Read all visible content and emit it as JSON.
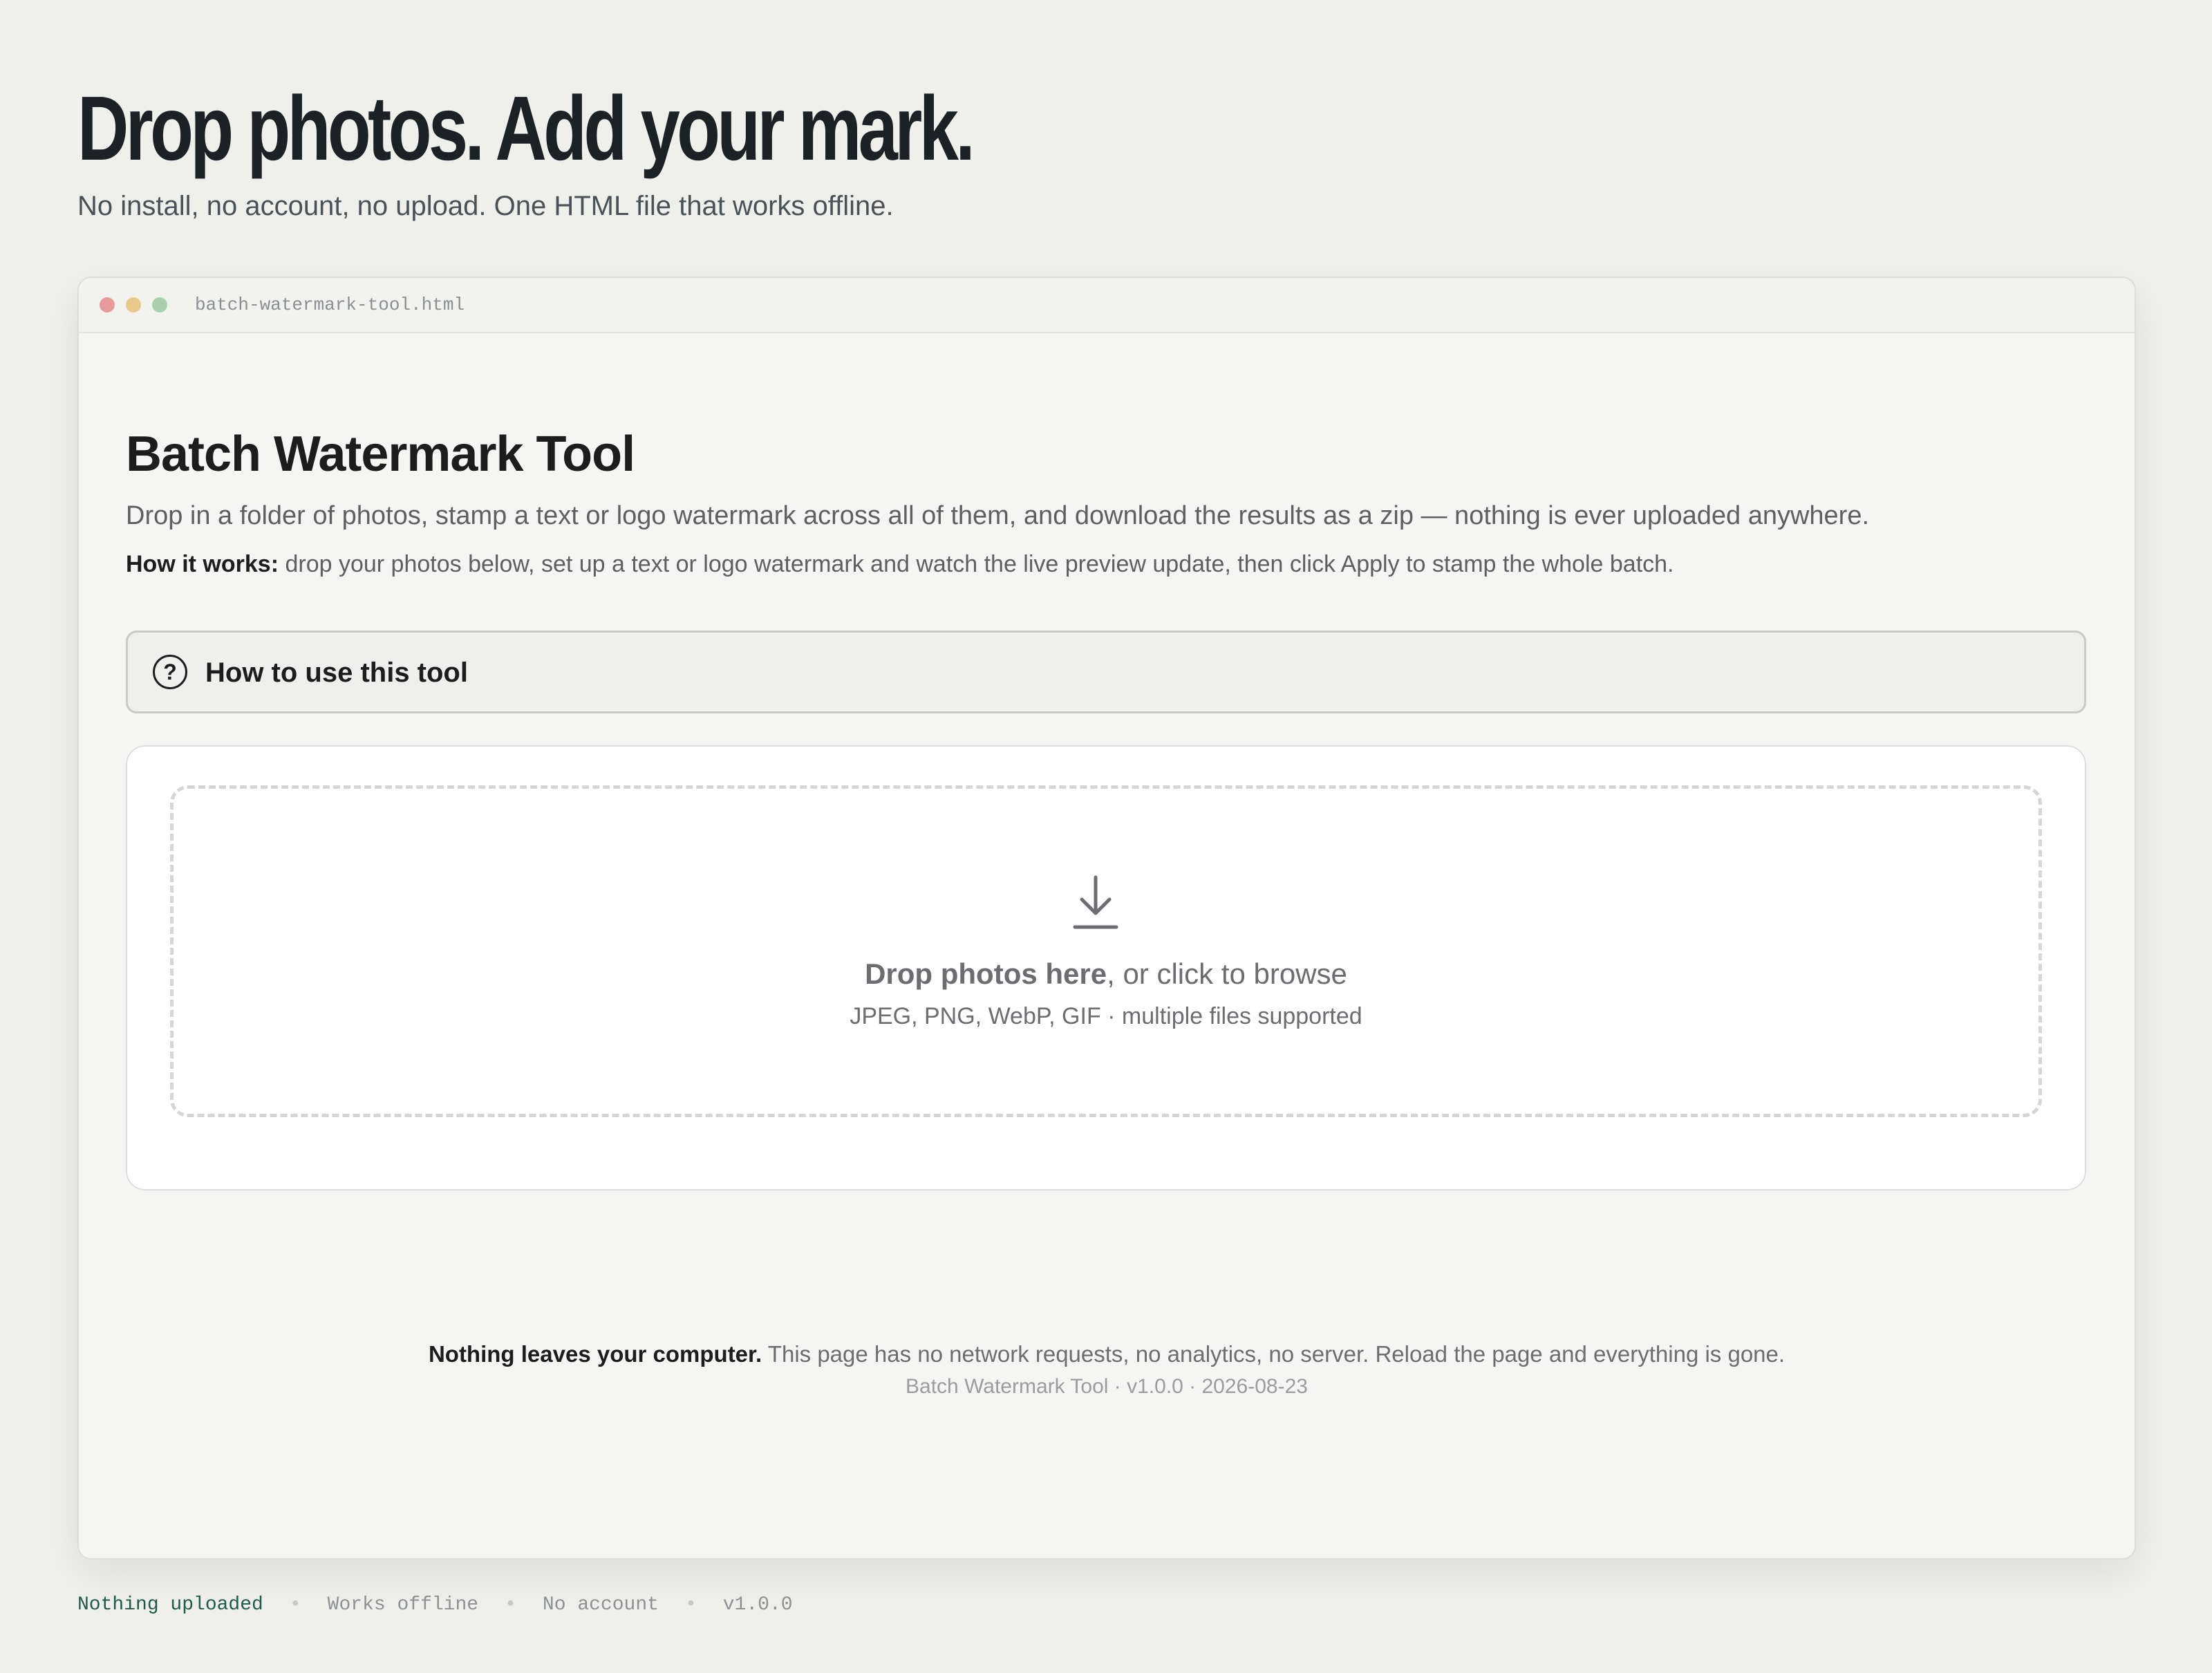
{
  "hero": {
    "title": "Drop photos. Add your mark.",
    "subtitle": "No install, no account, no upload. One HTML file that works offline."
  },
  "window": {
    "filename": "batch-watermark-tool.html"
  },
  "tool": {
    "title": "Batch Watermark Tool",
    "description": "Drop in a folder of photos, stamp a text or logo watermark across all of them, and download the results as a zip — nothing is ever uploaded anywhere.",
    "how_label": "How it works:",
    "how_text": " drop your photos below, set up a text or logo watermark and watch the live preview update, then click Apply to stamp the whole batch."
  },
  "help": {
    "icon": "question-circle-icon",
    "icon_glyph": "?",
    "label": "How to use this tool"
  },
  "dropzone": {
    "icon": "download-arrow-icon",
    "main_bold": "Drop photos here",
    "main_rest": ", or click to browse",
    "formats": "JPEG, PNG, WebP, GIF · multiple files supported"
  },
  "footer": {
    "privacy_bold": "Nothing leaves your computer.",
    "privacy_text": " This page has no network requests, no analytics, no server. Reload the page and everything is gone.",
    "version_line": "Batch Watermark Tool · v1.0.0 · 2026-08-23"
  },
  "statusbar": {
    "items": [
      "Nothing uploaded",
      "Works offline",
      "No account",
      "v1.0.0"
    ],
    "separator": "•",
    "accent_color": "#1f5a4c"
  },
  "colors": {
    "page_bg": "#eff0ec",
    "window_bg": "#f5f5f3",
    "traffic_red": "#e89a9a",
    "traffic_yellow": "#e8c98a",
    "traffic_green": "#a6d1ac"
  }
}
